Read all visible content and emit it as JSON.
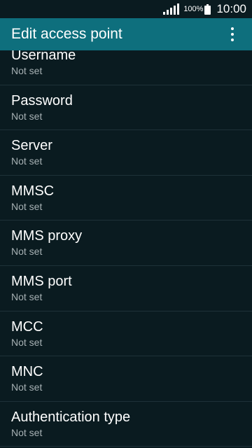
{
  "status_bar": {
    "battery": "100%",
    "time": "10:00"
  },
  "app_bar": {
    "title": "Edit access point",
    "menu_icon": "more-vert-icon"
  },
  "settings": [
    {
      "label": "Username",
      "value": "Not set"
    },
    {
      "label": "Password",
      "value": "Not set"
    },
    {
      "label": "Server",
      "value": "Not set"
    },
    {
      "label": "MMSC",
      "value": "Not set"
    },
    {
      "label": "MMS proxy",
      "value": "Not set"
    },
    {
      "label": "MMS port",
      "value": "Not set"
    },
    {
      "label": "MCC",
      "value": "Not set"
    },
    {
      "label": "MNC",
      "value": "Not set"
    },
    {
      "label": "Authentication type",
      "value": "Not set"
    }
  ]
}
